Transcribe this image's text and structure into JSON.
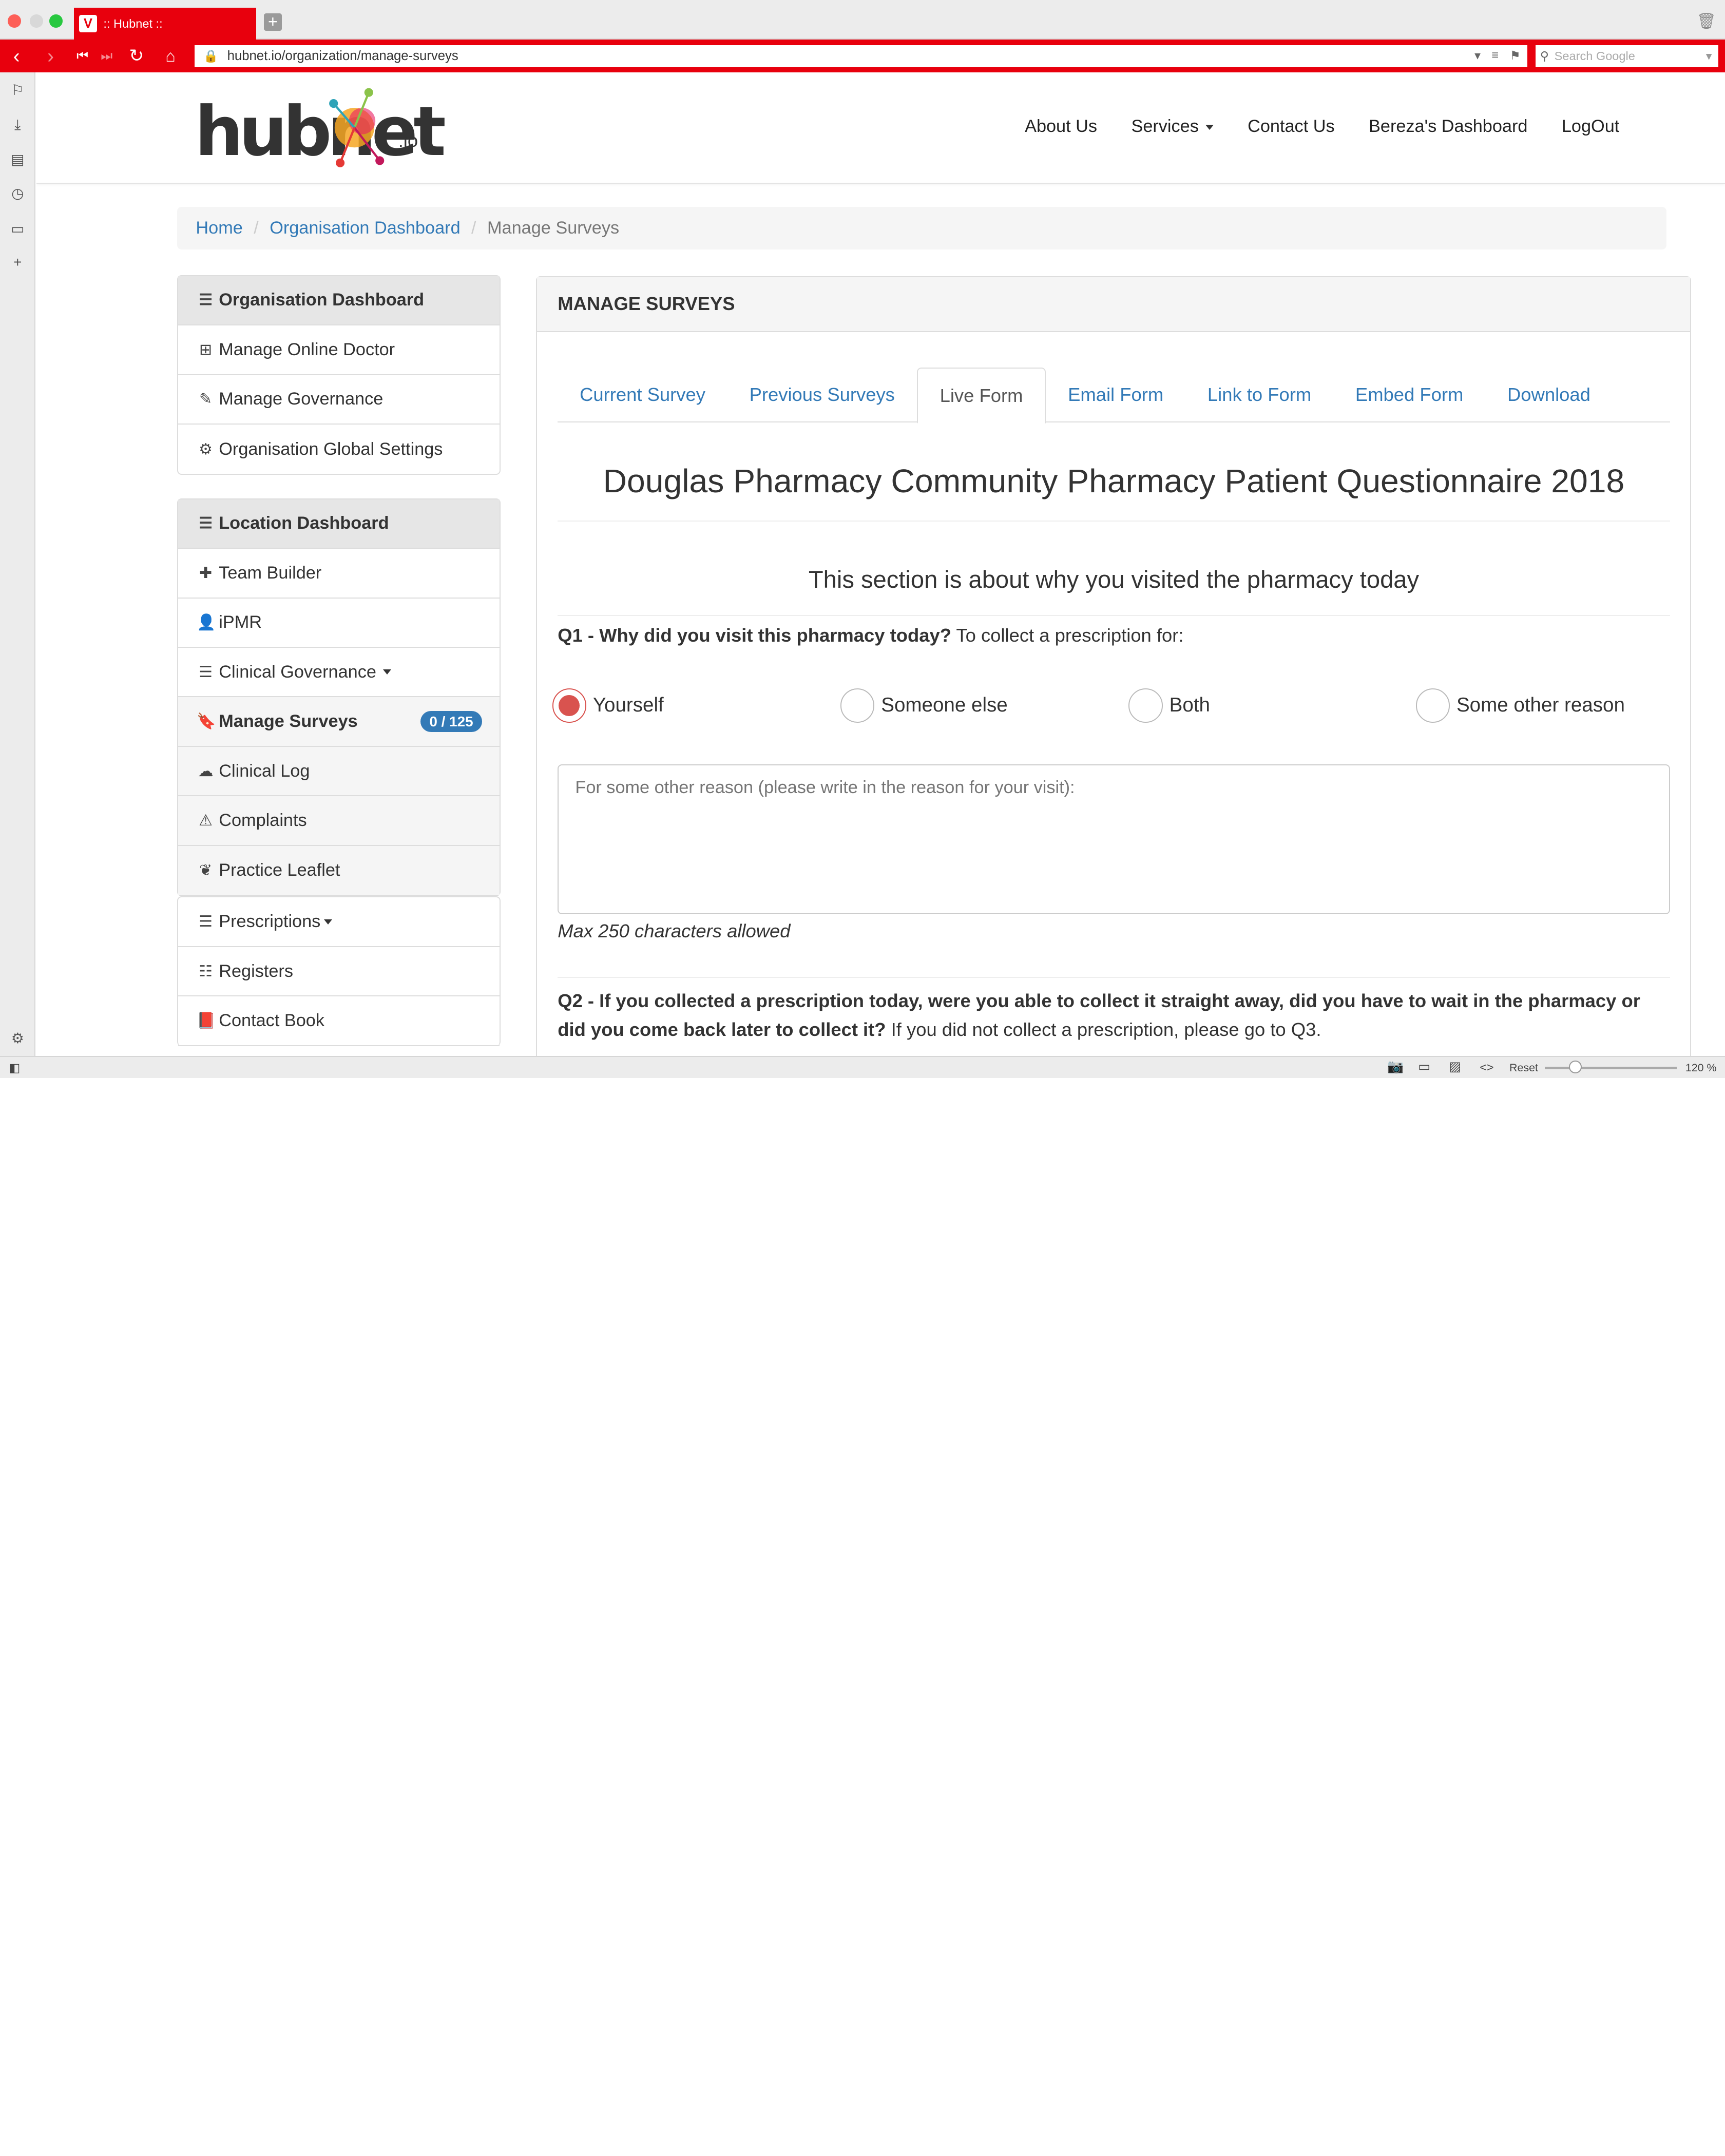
{
  "browser": {
    "tab_title": ":: Hubnet ::",
    "tab_logo": "V",
    "url": "hubnet.io/organization/manage-surveys",
    "search_placeholder": "Search Google",
    "zoom_label": "120 %",
    "reset_label": "Reset",
    "accent_color": "#e8000d"
  },
  "site": {
    "logo_text": "hubnet",
    "logo_suffix": ".io",
    "nav": {
      "about": "About Us",
      "services": "Services",
      "contact": "Contact Us",
      "dashboard": "Bereza's Dashboard",
      "logout": "LogOut"
    }
  },
  "breadcrumb": {
    "home": "Home",
    "org": "Organisation Dashboard",
    "current": "Manage Surveys"
  },
  "sidebar": {
    "org_group": {
      "title": "Organisation Dashboard",
      "items": [
        {
          "label": "Manage Online Doctor",
          "icon": "medkit-icon"
        },
        {
          "label": "Manage Governance",
          "icon": "pencil-icon"
        },
        {
          "label": "Organisation Global Settings",
          "icon": "cogs-icon"
        }
      ]
    },
    "loc_group": {
      "title": "Location Dashboard",
      "items": [
        {
          "label": "Team Builder",
          "icon": "plus-icon"
        },
        {
          "label": "iPMR",
          "icon": "user-icon"
        },
        {
          "label": "Clinical Governance",
          "icon": "menu-icon"
        },
        {
          "label": "Manage Surveys",
          "icon": "bookmark-icon",
          "badge": "0 / 125"
        },
        {
          "label": "Clinical Log",
          "icon": "cloud-upload-icon"
        },
        {
          "label": "Complaints",
          "icon": "warning-icon"
        },
        {
          "label": "Practice Leaflet",
          "icon": "leaf-icon"
        }
      ]
    },
    "other_group": {
      "items": [
        {
          "label": "Prescriptions",
          "icon": "menu-icon"
        },
        {
          "label": "Registers",
          "icon": "list-icon"
        },
        {
          "label": "Contact Book",
          "icon": "book-icon"
        }
      ]
    }
  },
  "main": {
    "panel_title": "MANAGE SURVEYS",
    "tabs": [
      "Current Survey",
      "Previous Surveys",
      "Live Form",
      "Email Form",
      "Link to Form",
      "Embed Form",
      "Download"
    ],
    "active_tab": "Live Form",
    "form_title": "Douglas Pharmacy Community Pharmacy Patient Questionnaire 2018",
    "section_title": "This section is about why you visited the pharmacy today",
    "q1_bold": "Q1 - Why did you visit this pharmacy today?",
    "q1_rest": " To collect a prescription for:",
    "q1_options": [
      "Yourself",
      "Someone else",
      "Both",
      "Some other reason"
    ],
    "q1_selected": "Yourself",
    "other_placeholder": "For some other reason (please write in the reason for your visit):",
    "max_note": "Max 250 characters allowed",
    "q2_bold": "Q2 - If you collected a prescription today, were you able to collect it straight away, did you have to wait in the pharmacy or did you come back later to collect it?",
    "q2_rest": " If you did not collect a prescription, please go to Q3."
  }
}
